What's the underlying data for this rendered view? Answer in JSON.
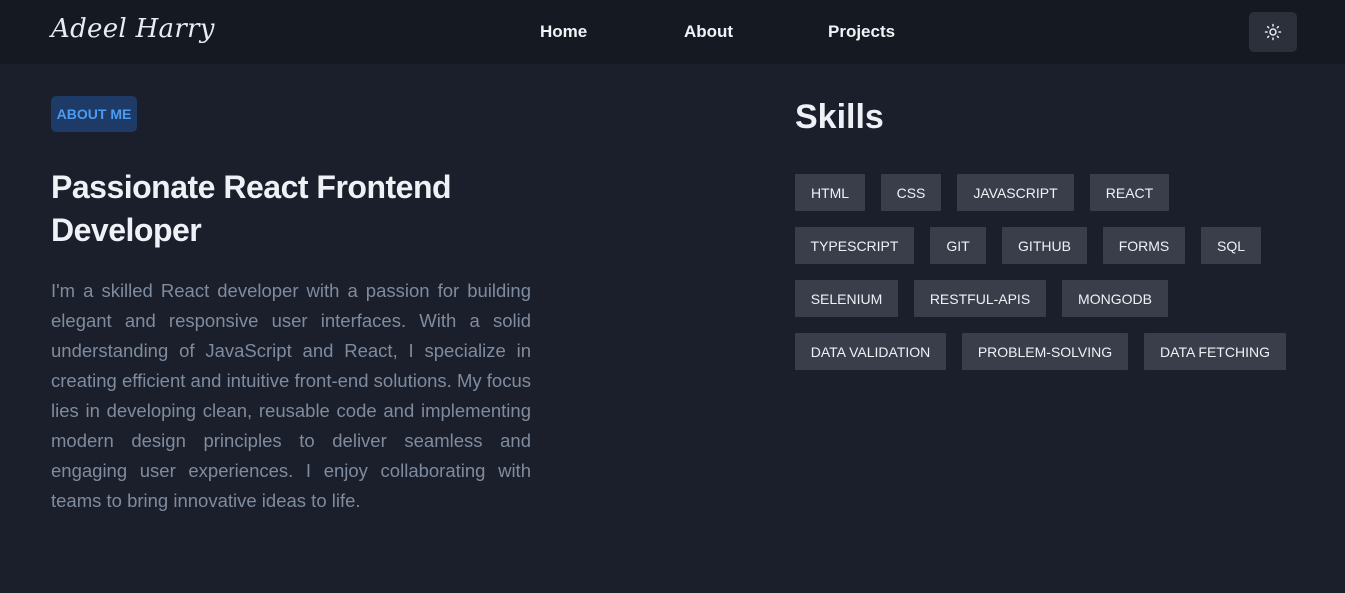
{
  "header": {
    "brand": "Adeel Harry",
    "nav": [
      "Home",
      "About",
      "Projects"
    ],
    "theme_toggle_icon": "sun-icon"
  },
  "about": {
    "badge": "ABOUT ME",
    "headline": "Passionate React Frontend Developer",
    "bio": "I'm a skilled React developer with a passion for building elegant and responsive user interfaces. With a solid understanding of JavaScript and React, I specialize in creating efficient and intuitive front-end solutions. My focus lies in developing clean, reusable code and implementing modern design principles to deliver seamless and engaging user experiences. I enjoy collaborating with teams to bring innovative ideas to life."
  },
  "skills": {
    "title": "Skills",
    "items": [
      "HTML",
      "CSS",
      "JAVASCRIPT",
      "REACT",
      "TYPESCRIPT",
      "GIT",
      "GITHUB",
      "FORMS",
      "SQL",
      "SELENIUM",
      "RESTFUL-APIS",
      "MONGODB",
      "DATA VALIDATION",
      "PROBLEM-SOLVING",
      "DATA FETCHING"
    ]
  },
  "colors": {
    "background": "#1b1f2b",
    "navbar": "#151922",
    "badge_bg": "#1e3a66",
    "badge_text": "#4d9bf0",
    "skill_chip": "#393e4a",
    "body_text": "#7f8b9e"
  }
}
